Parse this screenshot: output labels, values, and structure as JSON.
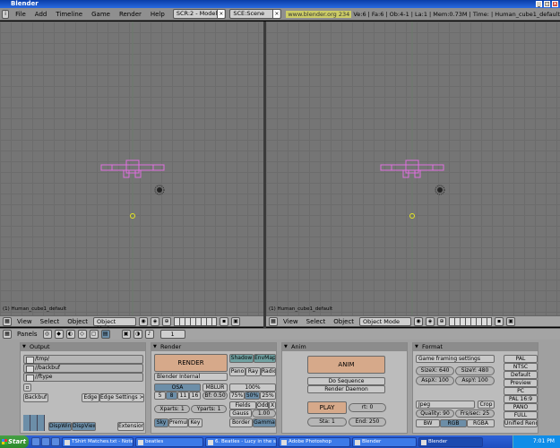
{
  "window": {
    "title": "Blender"
  },
  "menu": {
    "icon": "i",
    "items": [
      "File",
      "Add",
      "Timeline",
      "Game",
      "Render",
      "Help"
    ],
    "screen": "SCR:2 - Model",
    "scene": "SCE:Scene",
    "url": "www.blender.org 234",
    "stats": "Ve:6 | Fa:6 | Ob:4-1 | La:1 | Mem:0.73M | Time: | Human_cube1_default"
  },
  "viewports": {
    "left_label": "(1) Human_cube1_default",
    "right_label": "(1) Human_cube1_default"
  },
  "viewheader": {
    "view": "View",
    "select": "Select",
    "object": "Object",
    "mode": "Object Mode"
  },
  "buttonsheader": {
    "panels": "Panels",
    "frame": "1"
  },
  "output": {
    "title": "Output",
    "paths": [
      "/tmp/",
      "//backbuf",
      "//ftype"
    ],
    "backbuf": "Backbuf",
    "edge": "Edge",
    "edge_settings": "Edge Settings >>",
    "dispwin": "DispWin",
    "dispview": "DispView",
    "extensions": "Extension"
  },
  "render": {
    "title": "Render",
    "render": "RENDER",
    "engine": "Blender Internal",
    "shadow": "Shadow",
    "envmap": "EnvMap",
    "pano": "Pano",
    "ray": "Ray",
    "radio": "Radio",
    "osa": "OSA",
    "osa_vals": [
      "5",
      "8",
      "11",
      "16"
    ],
    "mblur": "MBLUR",
    "bf": "Bf: 0.50",
    "percent": "100%",
    "percents": [
      "75%",
      "50%",
      "25%"
    ],
    "xparts": "Xparts: 1",
    "yparts": "Yparts: 1",
    "fields": "Fields",
    "odd": "Odd",
    "x": "X",
    "gauss": "Gauss",
    "gauss_val": "1.00",
    "sky": "Sky",
    "premul": "Premul",
    "key": "Key",
    "border": "Border",
    "gamma": "Gamma"
  },
  "anim": {
    "title": "Anim",
    "anim": "ANIM",
    "do_sequence": "Do Sequence",
    "render_daemon": "Render Daemon",
    "play": "PLAY",
    "rt": "rt: 0",
    "sta": "Sta: 1",
    "end": "End: 250"
  },
  "format": {
    "title": "Format",
    "game_framing": "Game framing settings",
    "sizex": "SizeX: 640",
    "sizey": "SizeY: 480",
    "aspx": "AspX: 100",
    "aspy": "AspY: 100",
    "presets": [
      "PAL",
      "NTSC",
      "Default",
      "Preview",
      "PC",
      "PAL 16:9",
      "PANO",
      "FULL",
      "Unified Rende"
    ],
    "filetype": "Jpeg",
    "crop": "Crop",
    "quality": "Quality: 90",
    "fps": "Frs/sec: 25",
    "bw": "BW",
    "rgb": "RGB",
    "rgba": "RGBA"
  },
  "taskbar": {
    "start": "Start",
    "tasks": [
      "TShirt Matches.txt - Note...",
      "beatles",
      "6. Beatles - Lucy in the sk...",
      "Adobe Photoshop",
      "Blender",
      "Blender"
    ],
    "time": "7:01 PM"
  },
  "colors": {
    "accent_select": "#e070e0",
    "active_button": "#6c8ea8",
    "viewport_bg": "#757575"
  }
}
